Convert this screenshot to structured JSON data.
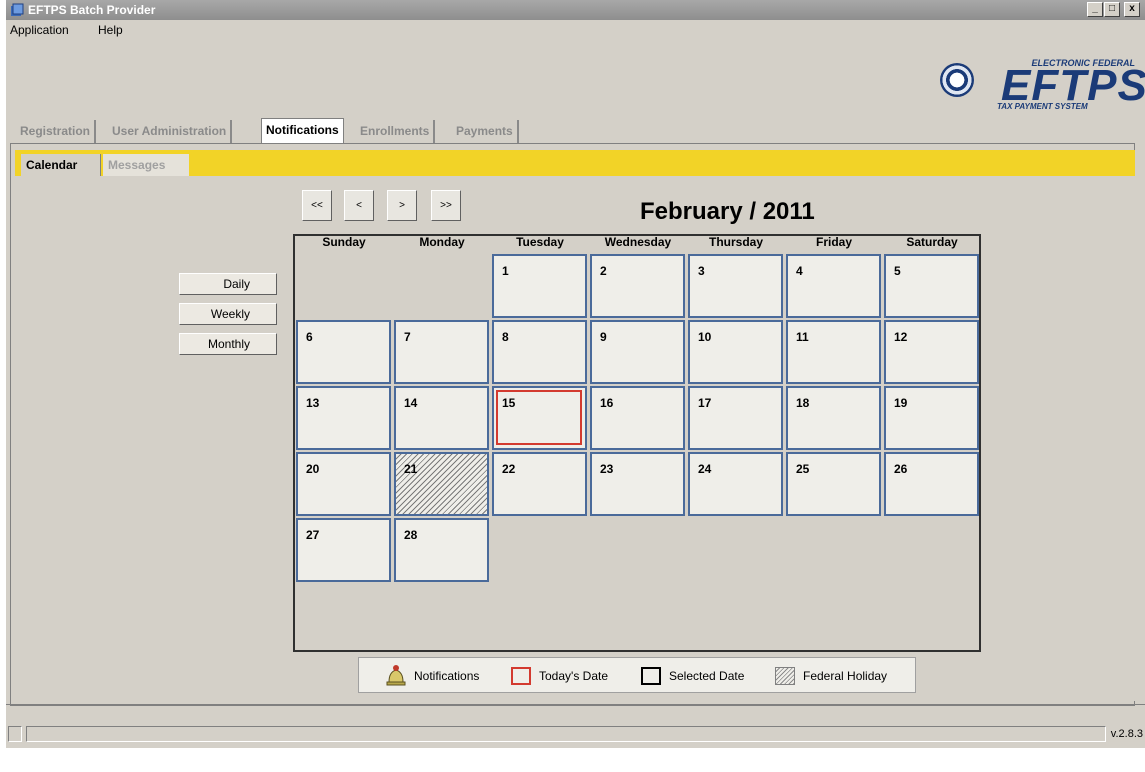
{
  "window": {
    "title": "EFTPS Batch Provider",
    "controls": [
      "_",
      "□",
      "x"
    ]
  },
  "menu": [
    "Application",
    "Help"
  ],
  "logo": {
    "line1": "ELECTRONIC FEDERAL",
    "line2": "EFTPS",
    "line3": "TAX PAYMENT SYSTEM"
  },
  "main_tabs": [
    {
      "label": "Registration",
      "active": false
    },
    {
      "label": "User Administration",
      "active": false
    },
    {
      "label": "Notifications",
      "active": true
    },
    {
      "label": "Enrollments",
      "active": false
    },
    {
      "label": "Payments",
      "active": false
    }
  ],
  "sub_tabs": [
    {
      "label": "Calendar",
      "active": true
    },
    {
      "label": "Messages",
      "active": false
    }
  ],
  "nav_buttons": [
    "<<",
    "<",
    ">",
    ">>"
  ],
  "calendar": {
    "title": "February / 2011",
    "weekdays": [
      "Sunday",
      "Monday",
      "Tuesday",
      "Wednesday",
      "Thursday",
      "Friday",
      "Saturday"
    ],
    "days": [
      "1",
      "2",
      "3",
      "4",
      "5",
      "6",
      "7",
      "8",
      "9",
      "10",
      "11",
      "12",
      "13",
      "14",
      "15",
      "16",
      "17",
      "18",
      "19",
      "20",
      "21",
      "22",
      "23",
      "24",
      "25",
      "26",
      "27",
      "28"
    ],
    "first_weekday_index": 2,
    "today": "15",
    "holiday": "21"
  },
  "view_buttons": [
    "Daily",
    "Weekly",
    "Monthly"
  ],
  "legend": {
    "notifications": "Notifications",
    "today": "Today's Date",
    "selected": "Selected Date",
    "holiday": "Federal Holiday"
  },
  "status": {
    "version": "v.2.8.3"
  },
  "colors": {
    "tab_strip": "#f2d327",
    "today_border": "#d33a2f",
    "cell_border": "#4a6a9a",
    "brand": "#1b3b78"
  }
}
